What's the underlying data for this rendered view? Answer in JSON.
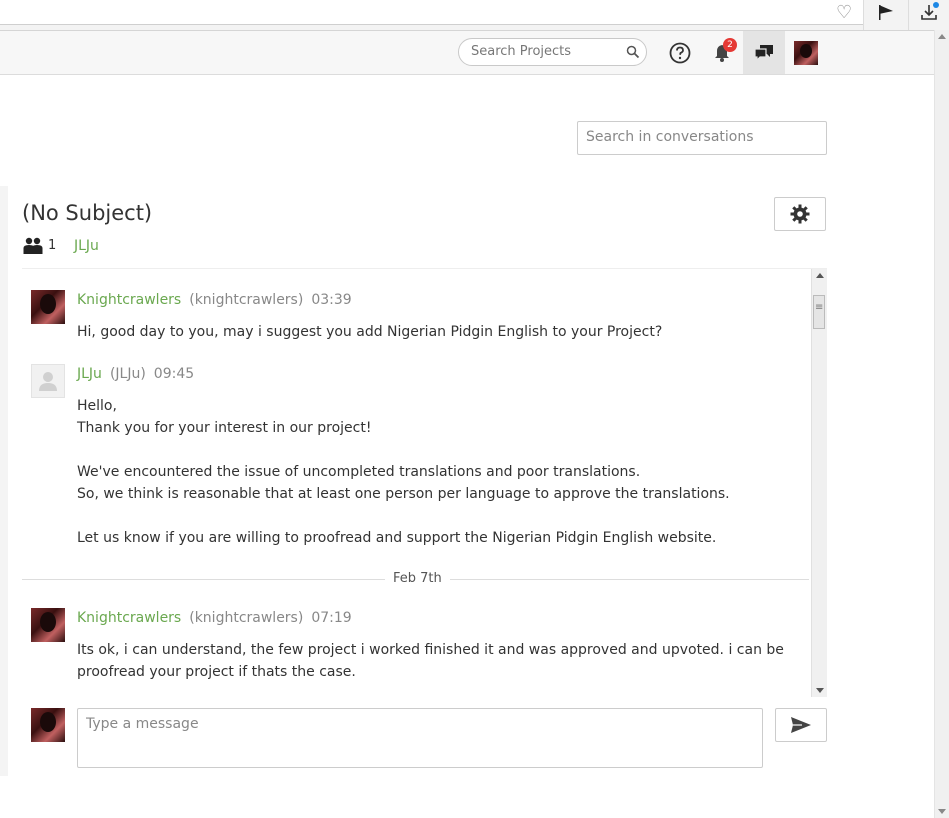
{
  "header": {
    "search_placeholder": "Search Projects",
    "notifications_count": "2"
  },
  "conversation": {
    "search_placeholder": "Search in conversations",
    "subject": "(No Subject)",
    "participants_count": "1",
    "participant_name": "JLJu",
    "date_divider": "Feb 7th",
    "messages": [
      {
        "name": "Knightcrawlers",
        "handle": "(knightcrawlers)",
        "time": "03:39",
        "text": "Hi, good day to you, may i suggest you add Nigerian Pidgin English to your Project?"
      },
      {
        "name": "JLJu",
        "handle": "(JLJu)",
        "time": "09:45",
        "text": "Hello,\nThank you for your interest in our project!\n\nWe've encountered the issue of uncompleted translations and poor translations.\nSo, we think is reasonable that at least one person per language to approve the translations.\n\nLet us know if you are willing to proofread and support the Nigerian Pidgin English website."
      },
      {
        "name": "Knightcrawlers",
        "handle": "(knightcrawlers)",
        "time": "07:19",
        "text": "Its ok, i can understand, the few project i worked finished it and was approved and upvoted. i can be proofread your project if thats the case."
      }
    ],
    "compose_placeholder": "Type a message"
  },
  "colors": {
    "accent_green": "#6aa84f",
    "badge_red": "#e53935"
  },
  "icons": [
    "heart-icon",
    "flag-icon",
    "download-icon",
    "search-icon",
    "help-icon",
    "bell-icon",
    "messages-icon",
    "gear-icon",
    "people-icon",
    "send-icon"
  ]
}
